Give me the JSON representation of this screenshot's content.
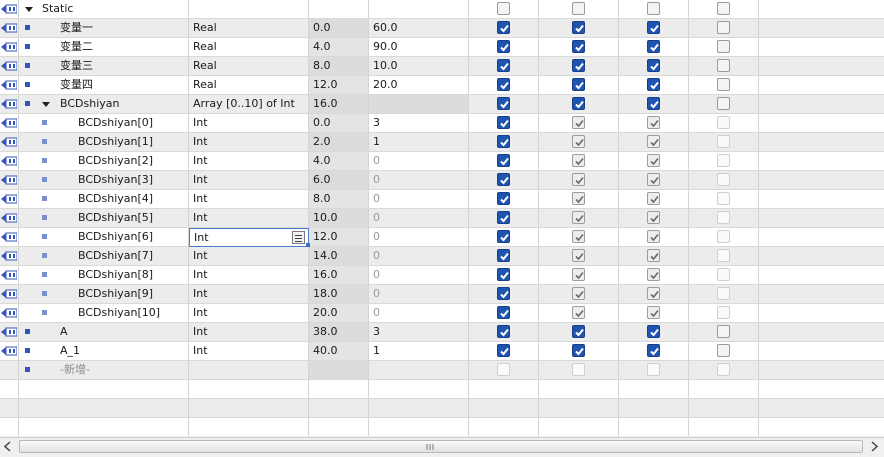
{
  "rows": [
    {
      "kind": "header",
      "name": "Static",
      "type": "",
      "offset": "",
      "start": "",
      "cb": [
        "off",
        "off",
        "off",
        "off"
      ]
    },
    {
      "kind": "var",
      "name": "变量一",
      "type": "Real",
      "offset": "0.0",
      "start": "60.0",
      "cb": [
        "on",
        "on",
        "on",
        "off"
      ]
    },
    {
      "kind": "var",
      "name": "变量二",
      "type": "Real",
      "offset": "4.0",
      "start": "90.0",
      "cb": [
        "on",
        "on",
        "on",
        "off"
      ]
    },
    {
      "kind": "var",
      "name": "变量三",
      "type": "Real",
      "offset": "8.0",
      "start": "10.0",
      "cb": [
        "on",
        "on",
        "on",
        "off"
      ]
    },
    {
      "kind": "var",
      "name": "变量四",
      "type": "Real",
      "offset": "12.0",
      "start": "20.0",
      "cb": [
        "on",
        "on",
        "on",
        "off"
      ]
    },
    {
      "kind": "array",
      "name": "BCDshiyan",
      "type": "Array [0..10] of Int",
      "offset": "16.0",
      "start": "",
      "cb": [
        "on",
        "on",
        "on",
        "off"
      ]
    },
    {
      "kind": "elem",
      "name": "BCDshiyan[0]",
      "type": "Int",
      "offset": "0.0",
      "start": "3",
      "cb": [
        "on",
        "grey",
        "grey",
        "faint"
      ]
    },
    {
      "kind": "elem",
      "name": "BCDshiyan[1]",
      "type": "Int",
      "offset": "2.0",
      "start": "1",
      "cb": [
        "on",
        "grey",
        "grey",
        "faint"
      ]
    },
    {
      "kind": "elem",
      "name": "BCDshiyan[2]",
      "type": "Int",
      "offset": "4.0",
      "start": "0",
      "cb": [
        "on",
        "grey",
        "grey",
        "faint"
      ]
    },
    {
      "kind": "elem",
      "name": "BCDshiyan[3]",
      "type": "Int",
      "offset": "6.0",
      "start": "0",
      "cb": [
        "on",
        "grey",
        "grey",
        "faint"
      ]
    },
    {
      "kind": "elem",
      "name": "BCDshiyan[4]",
      "type": "Int",
      "offset": "8.0",
      "start": "0",
      "cb": [
        "on",
        "grey",
        "grey",
        "faint"
      ]
    },
    {
      "kind": "elem",
      "name": "BCDshiyan[5]",
      "type": "Int",
      "offset": "10.0",
      "start": "0",
      "cb": [
        "on",
        "grey",
        "grey",
        "faint"
      ]
    },
    {
      "kind": "elem",
      "name": "BCDshiyan[6]",
      "type": "Int",
      "offset": "12.0",
      "start": "0",
      "cb": [
        "on",
        "grey",
        "grey",
        "faint"
      ],
      "editing": true
    },
    {
      "kind": "elem",
      "name": "BCDshiyan[7]",
      "type": "Int",
      "offset": "14.0",
      "start": "0",
      "cb": [
        "on",
        "grey",
        "grey",
        "faint"
      ]
    },
    {
      "kind": "elem",
      "name": "BCDshiyan[8]",
      "type": "Int",
      "offset": "16.0",
      "start": "0",
      "cb": [
        "on",
        "grey",
        "grey",
        "faint"
      ]
    },
    {
      "kind": "elem",
      "name": "BCDshiyan[9]",
      "type": "Int",
      "offset": "18.0",
      "start": "0",
      "cb": [
        "on",
        "grey",
        "grey",
        "faint"
      ]
    },
    {
      "kind": "elem",
      "name": "BCDshiyan[10]",
      "type": "Int",
      "offset": "20.0",
      "start": "0",
      "cb": [
        "on",
        "grey",
        "grey",
        "faint"
      ]
    },
    {
      "kind": "var",
      "name": "A",
      "type": "Int",
      "offset": "38.0",
      "start": "3",
      "cb": [
        "on",
        "on",
        "on",
        "off"
      ]
    },
    {
      "kind": "var",
      "name": "A_1",
      "type": "Int",
      "offset": "40.0",
      "start": "1",
      "cb": [
        "on",
        "on",
        "on",
        "off"
      ]
    },
    {
      "kind": "add",
      "name": "-新增-",
      "type": "",
      "offset": "",
      "start": "",
      "cb": [
        "faint",
        "faint",
        "faint",
        "faint"
      ]
    },
    {
      "kind": "blank",
      "name": "",
      "type": "",
      "offset": "",
      "start": "",
      "cb": []
    },
    {
      "kind": "blank",
      "name": "",
      "type": "",
      "offset": "",
      "start": "",
      "cb": []
    },
    {
      "kind": "blank",
      "name": "",
      "type": "",
      "offset": "",
      "start": "",
      "cb": []
    }
  ],
  "colors": {
    "accent_blue": "#1f55b0",
    "row_alt": "#ececec",
    "io_icon": "#3355bb",
    "grid_line": "#d4d4d4"
  },
  "icons": {
    "row_io": "interface-io-icon",
    "member": "member-square-icon",
    "expand": "triangle-down-icon",
    "dropdown": "list-dropdown-icon",
    "scroll_left": "chevron-left-icon",
    "scroll_right": "chevron-right-icon"
  }
}
